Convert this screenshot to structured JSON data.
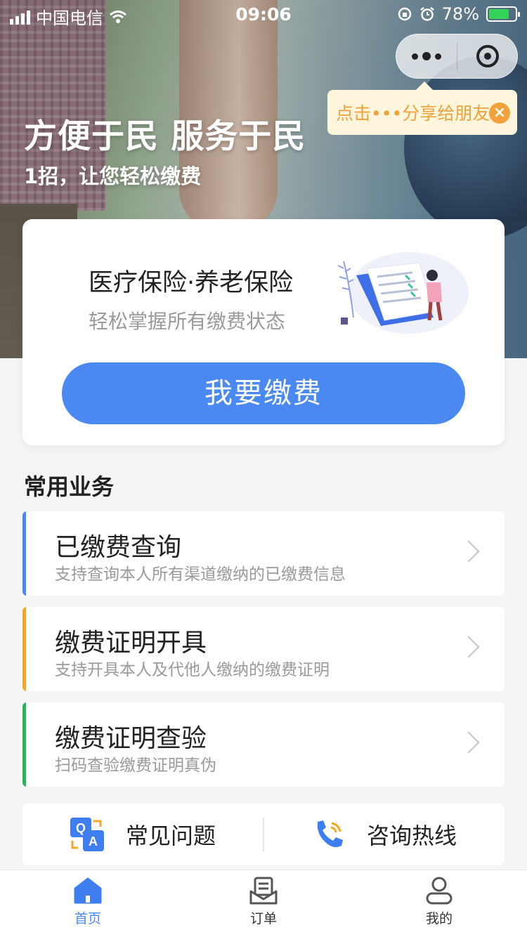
{
  "status_bar": {
    "carrier": "中国电信",
    "time": "09:06",
    "battery": "78%"
  },
  "capsule": {
    "more_icon": "more-dots-icon",
    "close_icon": "target-close-icon"
  },
  "tooltip": {
    "text": "点击•••分享给朋友",
    "close": "×"
  },
  "hero": {
    "slogan": "方便于民 服务于民",
    "subtitle": "1招，让您轻松缴费"
  },
  "main_card": {
    "title": "医疗保险·养老保险",
    "subtitle": "轻松掌握所有缴费状态",
    "button": "我要缴费"
  },
  "section": {
    "title": "常用业务"
  },
  "services": [
    {
      "title": "已缴费查询",
      "desc": "支持查询本人所有渠道缴纳的已缴费信息",
      "color": "#4a88f2"
    },
    {
      "title": "缴费证明开具",
      "desc": "支持开具本人及代他人缴纳的缴费证明",
      "color": "#f5a623"
    },
    {
      "title": "缴费证明查验",
      "desc": "扫码查验缴费证明真伪",
      "color": "#2bb35a"
    }
  ],
  "quick_links": {
    "faq": "常见问题",
    "hotline": "咨询热线"
  },
  "tabbar": {
    "home": "首页",
    "orders": "订单",
    "mine": "我的"
  },
  "colors": {
    "accent": "#4a88f2",
    "tip_text": "#f0a23a"
  }
}
